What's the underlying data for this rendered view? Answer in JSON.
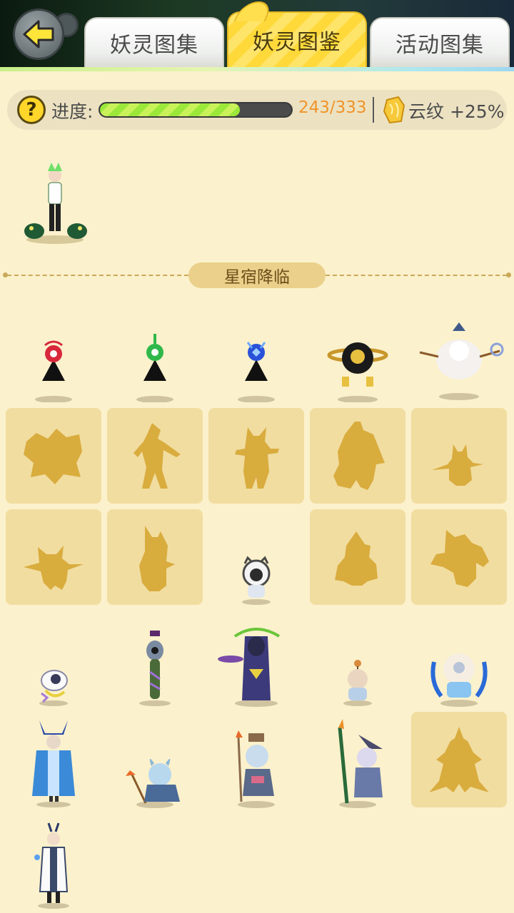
{
  "header": {
    "back_icon": "back-arrow-icon",
    "tabs": [
      {
        "label": "妖灵图集",
        "active": false
      },
      {
        "label": "妖灵图鉴",
        "active": true
      },
      {
        "label": "活动图集",
        "active": false
      }
    ]
  },
  "progress": {
    "help_icon": "question-mark-icon",
    "label": "进度:",
    "count_text": "243/333",
    "collected": 243,
    "total": 333,
    "bonus_icon": "cloud-pattern-icon",
    "bonus_text": "云纹 +25%"
  },
  "section": {
    "title": "星宿降临"
  },
  "colors": {
    "accent_yellow": "#ffd93a",
    "progress_fill": "#9be83a",
    "count_orange": "#f0942a",
    "locked_slot": "#f1dda0",
    "silhouette": "#d9ac3e",
    "background": "#fbf1cc"
  }
}
